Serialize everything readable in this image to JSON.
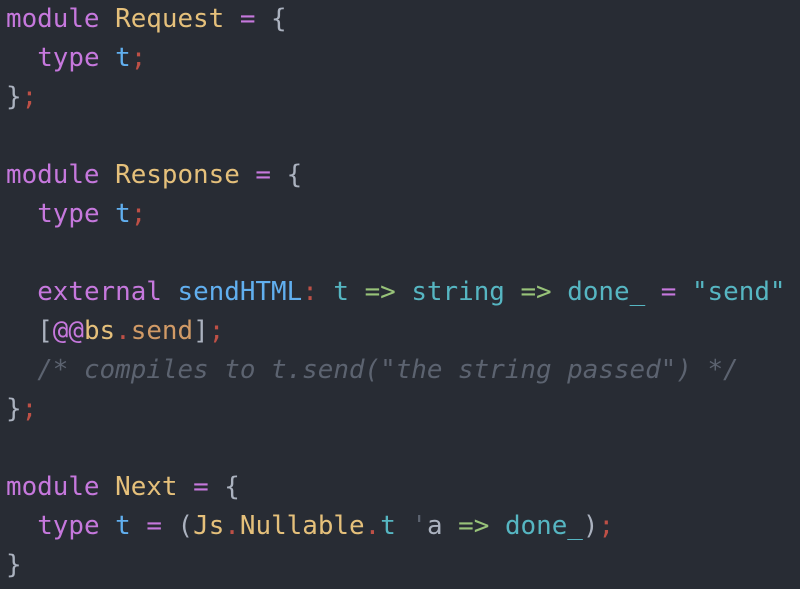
{
  "code": {
    "l1": {
      "kw": "module",
      "name": "Request",
      "eq": "=",
      "brace": "{"
    },
    "l2": {
      "kw": "type",
      "t": "t",
      "semi": ";"
    },
    "l3": {
      "brace": "}",
      "semi": ";"
    },
    "l5": {
      "kw": "module",
      "name": "Response",
      "eq": "=",
      "brace": "{"
    },
    "l6": {
      "kw": "type",
      "t": "t",
      "semi": ";"
    },
    "l8": {
      "kw": "external",
      "fn": "sendHTML",
      "colon": ":",
      "t": "t",
      "arrow1": "=>",
      "string_type": "string",
      "arrow2": "=>",
      "done": "done_",
      "eq": "=",
      "str": "\"send\""
    },
    "l9": {
      "open": "[",
      "at": "@@",
      "ns": "bs",
      "dot": ".",
      "field": "send",
      "close": "]",
      "semi": ";"
    },
    "l10": {
      "comment": "/* compiles to t.send(\"the string passed\") */"
    },
    "l11": {
      "brace": "}",
      "semi": ";"
    },
    "l13": {
      "kw": "module",
      "name": "Next",
      "eq": "=",
      "brace": "{"
    },
    "l14": {
      "kw": "type",
      "t": "t",
      "eq": "=",
      "paren_open": "(",
      "js": "Js",
      "dot1": ".",
      "nullable": "Nullable",
      "dot2": ".",
      "t2": "t",
      "tick": "'",
      "a": "a",
      "arrow": "=>",
      "done": "done_",
      "paren_close": ")",
      "semi": ";"
    },
    "l15": {
      "brace": "}"
    }
  },
  "colors": {
    "background": "#282c34",
    "keyword": "#c678dd",
    "module_name": "#e5c07b",
    "type_name": "#61afef",
    "arrow": "#98c379",
    "string": "#56b6c2",
    "semicolon": "#be5046",
    "comment": "#5c6370",
    "text": "#abb2bf"
  }
}
